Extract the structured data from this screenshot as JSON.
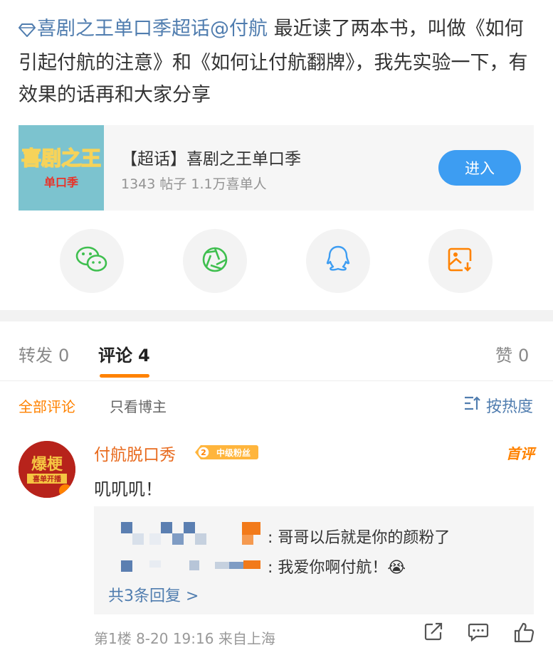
{
  "post": {
    "topic_link": "喜剧之王单口季超话",
    "mention": "@付航",
    "body": " 最近读了两本书，叫做《如何引起付航的注意》和《如何让付航翻牌》，我先实验一下，有效果的话再和大家分享"
  },
  "topic_card": {
    "thumb_title": "喜剧之王",
    "thumb_subtitle": "单口季",
    "title": "【超话】喜剧之王单口季",
    "stats": "1343 帖子 1.1万喜单人",
    "enter_label": "进入"
  },
  "share": {
    "icons": [
      "wechat-icon",
      "moments-icon",
      "qq-icon",
      "save-image-icon"
    ]
  },
  "tabs": {
    "repost_label": "转发",
    "repost_count": "0",
    "comment_label": "评论",
    "comment_count": "4",
    "like_label": "赞",
    "like_count": "0"
  },
  "filters": {
    "all_label": "全部评论",
    "author_only_label": "只看博主",
    "sort_label": "按热度"
  },
  "comment": {
    "avatar_text": "爆梗",
    "avatar_subtext": "喜单开播",
    "username": "付航脱口秀",
    "fan_level": "2",
    "fan_badge": "中级粉丝",
    "first_badge": "首评",
    "text": "叽叽叽！",
    "replies": [
      {
        "text": ": 哥哥以后就是你的颜粉了"
      },
      {
        "text": ": 我爱你啊付航！😭"
      }
    ],
    "more_replies": "共3条回复 >",
    "meta": "第1楼  8-20 19:16  来自上海"
  },
  "colors": {
    "link": "#507daf",
    "accent": "#ff8200",
    "button": "#3d9df2"
  }
}
